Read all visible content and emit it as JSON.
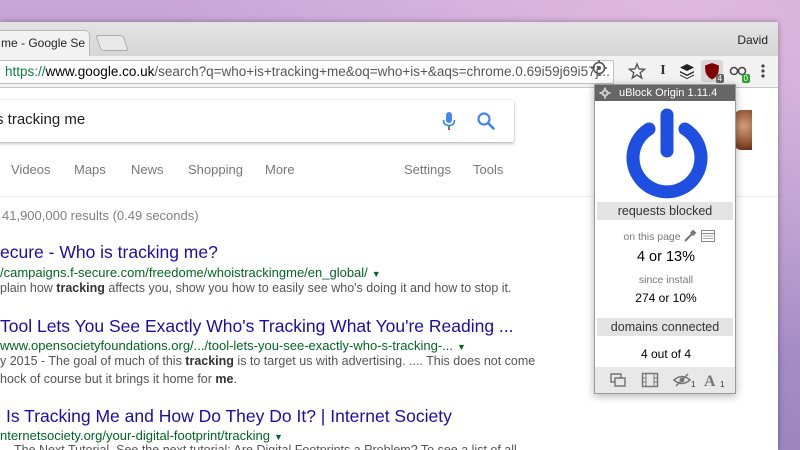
{
  "browser": {
    "tab_title": "me - Google Se",
    "profile_name": "David",
    "url_scheme": "https://",
    "url_host": "www.google.co.uk",
    "url_path": "/search?q=who+is+tracking+me&oq=who+is+&aqs=chrome.0.69i59j69i57j...",
    "ext_badge_ublock": "4",
    "ext_badge_other": "0",
    "ext_text_icon": "I"
  },
  "search": {
    "query": "s tracking me"
  },
  "nav": {
    "videos": "Videos",
    "maps": "Maps",
    "news": "News",
    "shopping": "Shopping",
    "more": "More",
    "settings": "Settings",
    "tools": "Tools"
  },
  "stats": "41,900,000 results (0.49 seconds)",
  "results": [
    {
      "title": "ecure - Who is tracking me?",
      "url": "/campaigns.f-secure.com/freedome/whoistrackingme/en_global/",
      "snippet_pre": "plain how ",
      "snippet_bold": "tracking",
      "snippet_post": " affects you, show you how to easily see who's doing it and how to stop it."
    },
    {
      "title": "Tool Lets You See Exactly Who's Tracking What You're Reading ...",
      "url": "www.opensocietyfoundations.org/.../tool-lets-you-see-exactly-who-s-tracking-...",
      "snippet1_pre": "y 2015 - The goal of much of this ",
      "snippet1_bold": "tracking",
      "snippet1_post": " is to target us with advertising. .... This does not come",
      "snippet2_pre": "hock of course but it brings it home for ",
      "snippet2_bold": "me",
      "snippet2_post": "."
    },
    {
      "title": "Is Tracking Me and How Do They Do It? | Internet Society",
      "url": "nternetsociety.org/your-digital-footprint/tracking",
      "snippet": "The Next Tutorial. See the next tutorial: Are Digital Footprints a Problem? To see a list of all"
    }
  ],
  "ublock": {
    "header": "uBlock Origin 1.11.4",
    "requests_blocked_label": "requests blocked",
    "on_this_page_label": "on this page",
    "on_this_page_value": "4 or 13%",
    "since_install_label": "since install",
    "since_install_value": "274 or 10%",
    "domains_connected_label": "domains connected",
    "domains_connected_value": "4 out of 4",
    "footer_badge_1": "1",
    "footer_badge_2": "1",
    "accent_color": "#1e4fe0"
  }
}
